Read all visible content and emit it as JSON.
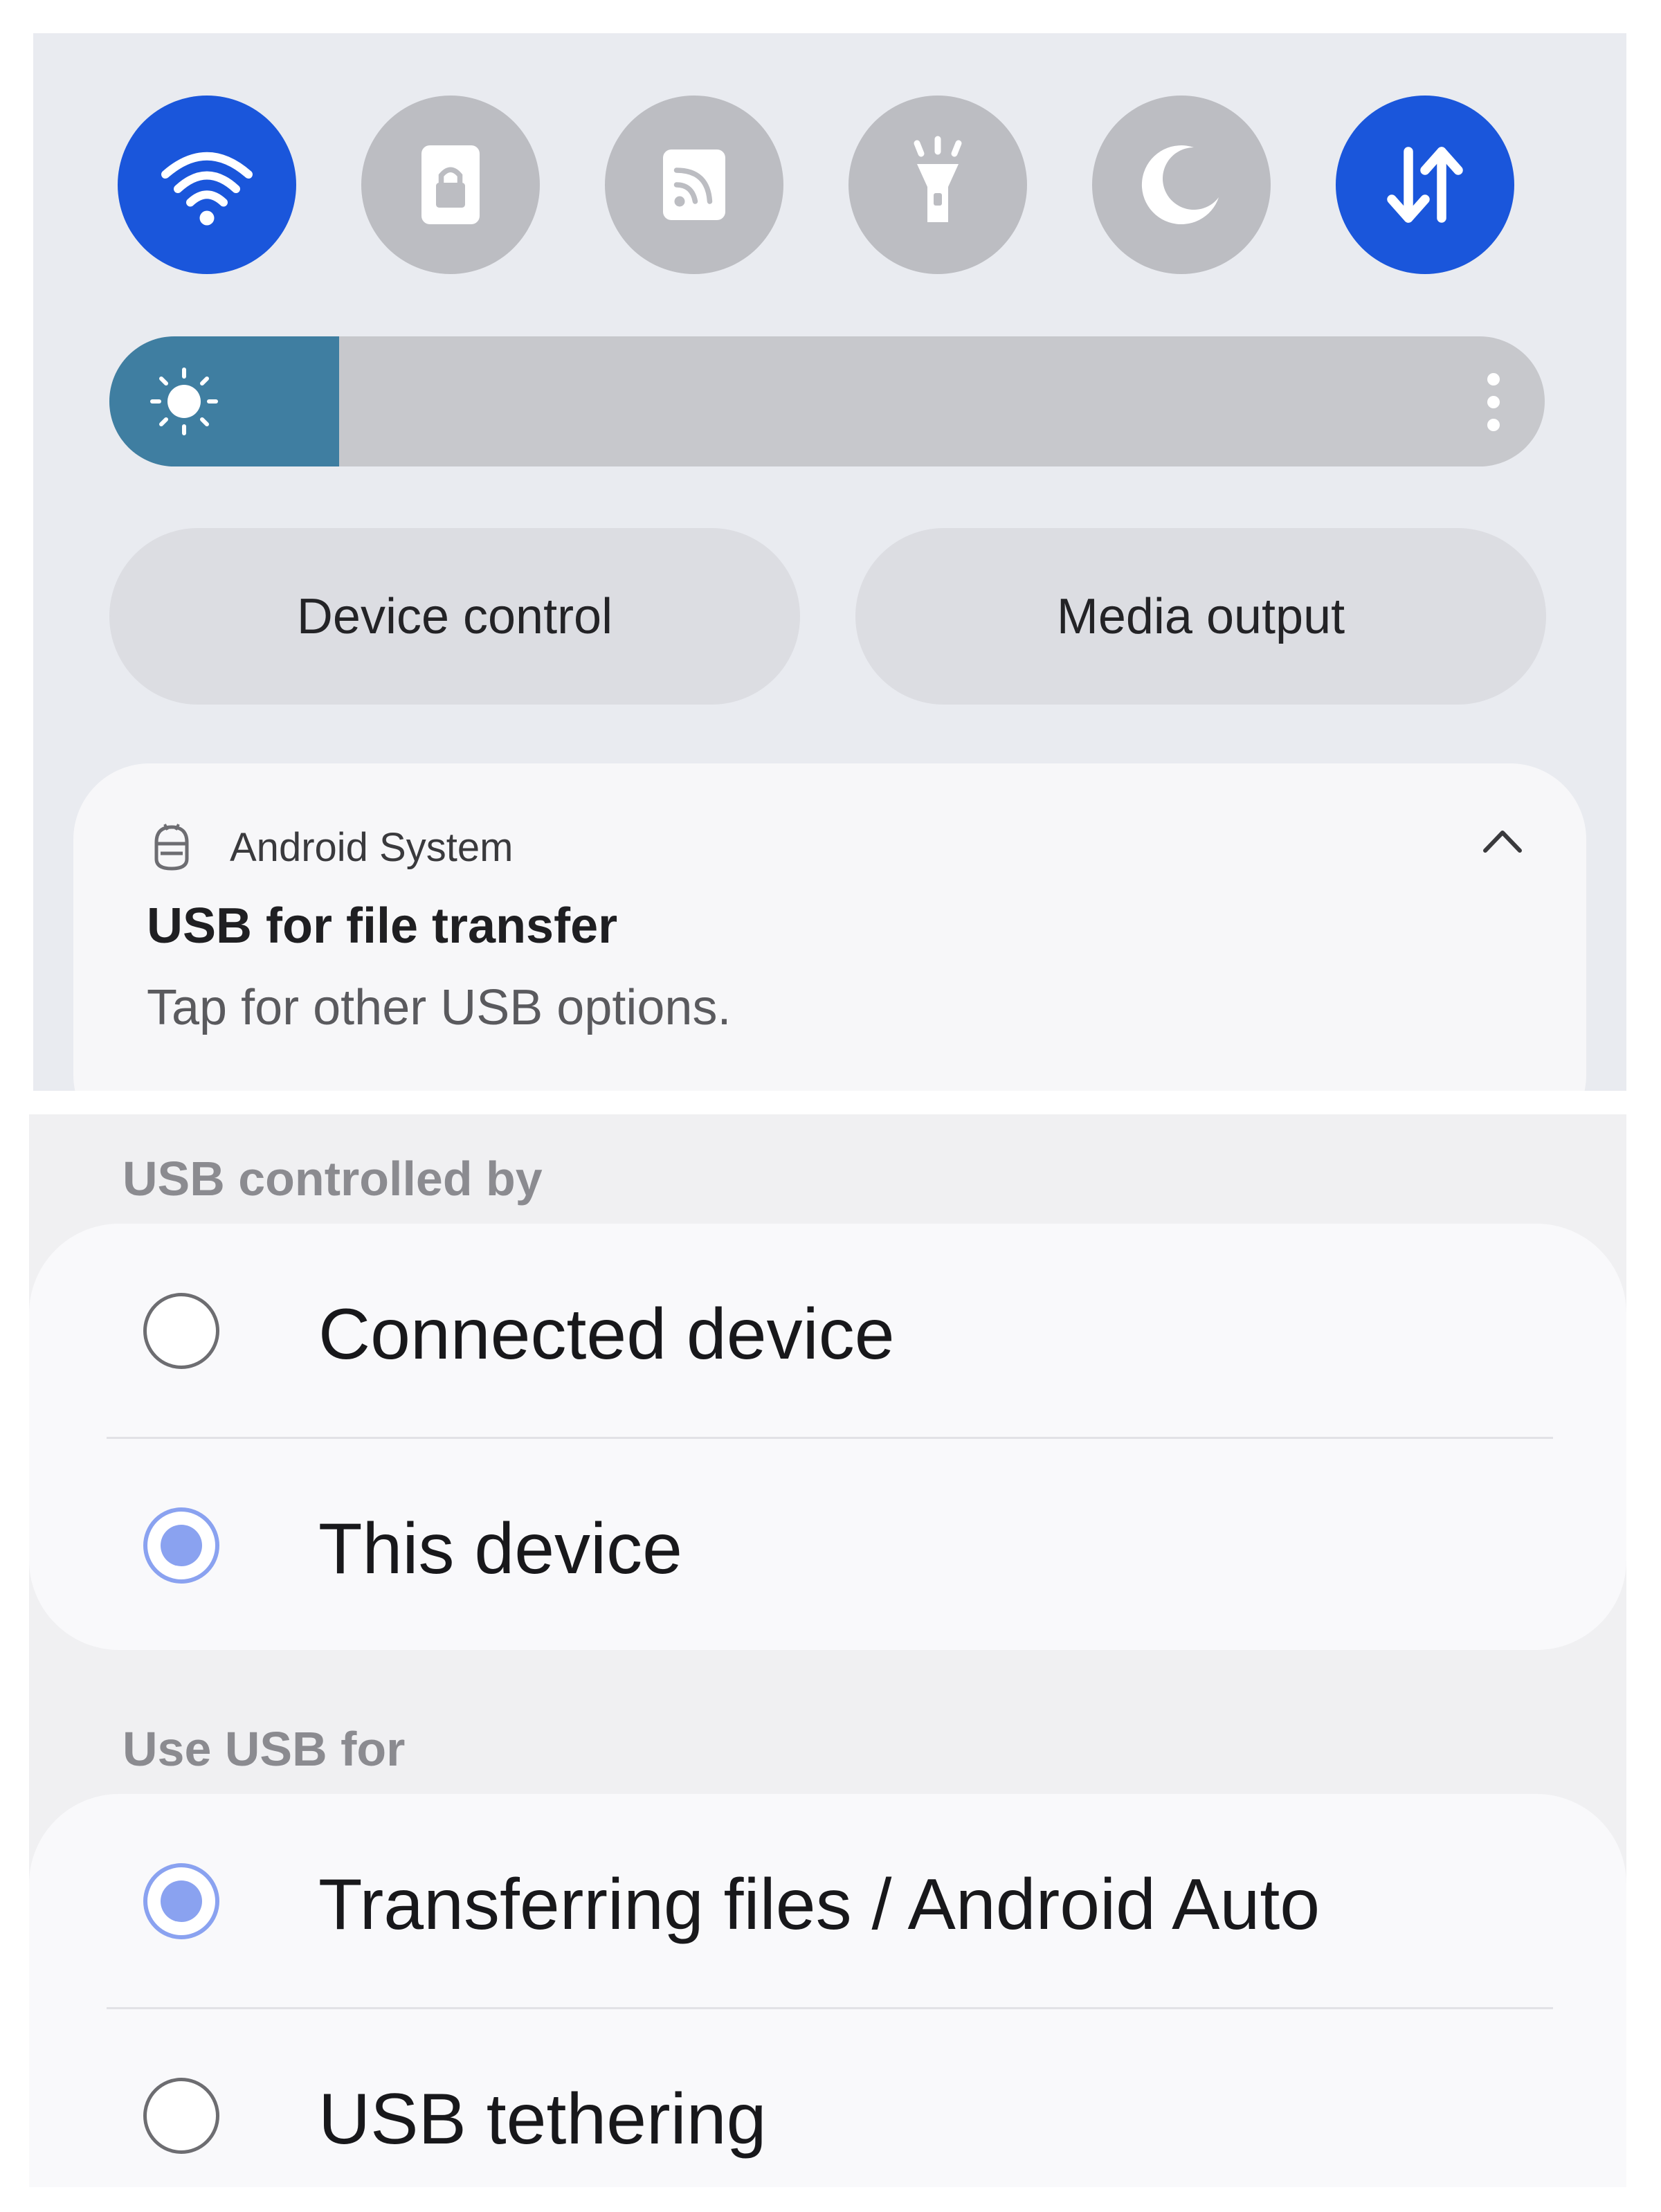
{
  "quick_settings": {
    "tiles": [
      {
        "name": "wifi",
        "icon": "wifi-icon",
        "state": "on"
      },
      {
        "name": "secure-folder",
        "icon": "lock-icon",
        "state": "off"
      },
      {
        "name": "cast",
        "icon": "cast-icon",
        "state": "off"
      },
      {
        "name": "flashlight",
        "icon": "flashlight-icon",
        "state": "off"
      },
      {
        "name": "night-mode",
        "icon": "moon-icon",
        "state": "off"
      },
      {
        "name": "mobile-data",
        "icon": "data-arrows-icon",
        "state": "on"
      }
    ],
    "brightness": {
      "level": 0.16,
      "icon": "sun-icon",
      "more_icon": "more-vertical-icon"
    },
    "device_control_label": "Device control",
    "media_output_label": "Media output"
  },
  "notification": {
    "app_icon": "android-system-icon",
    "app_name": "Android System",
    "title": "USB for file transfer",
    "text": "Tap for other USB options.",
    "expand_icon": "chevron-up-icon"
  },
  "usb_settings": {
    "controlled_by_label": "USB controlled by",
    "controlled_by_options": [
      {
        "label": "Connected device",
        "selected": false
      },
      {
        "label": "This device",
        "selected": true
      }
    ],
    "use_for_label": "Use USB for",
    "use_for_options": [
      {
        "label": "Transferring files / Android Auto",
        "selected": true
      },
      {
        "label": "USB tethering",
        "selected": false
      }
    ]
  },
  "colors": {
    "accent_blue": "#1a56db",
    "brightness_fill": "#3f7ea1",
    "radio_selected": "#8aa2f0",
    "tile_off": "#bcbdc2"
  }
}
